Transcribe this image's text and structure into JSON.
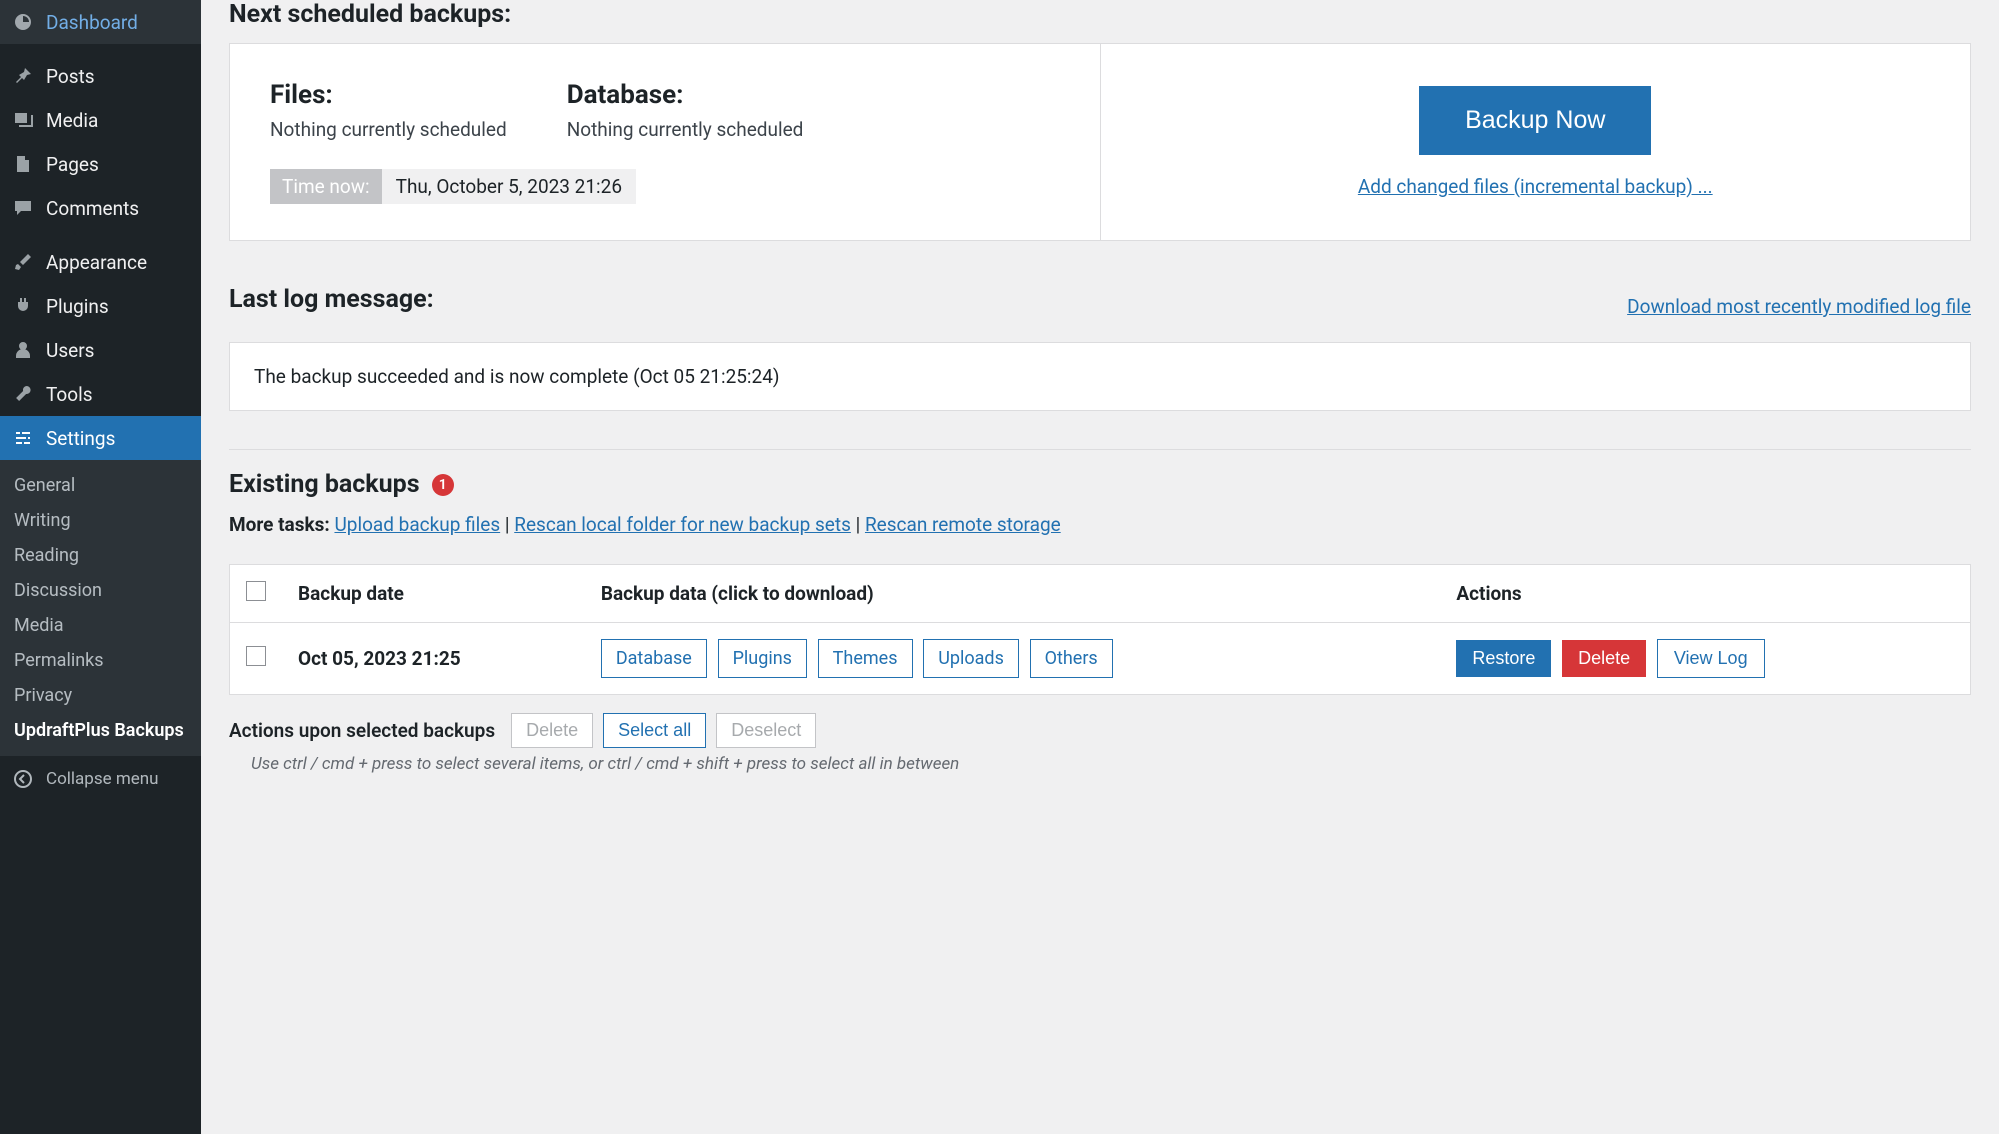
{
  "sidebar": {
    "items": [
      {
        "label": "Dashboard",
        "name": "dashboard"
      },
      {
        "label": "Posts",
        "name": "posts"
      },
      {
        "label": "Media",
        "name": "media"
      },
      {
        "label": "Pages",
        "name": "pages"
      },
      {
        "label": "Comments",
        "name": "comments"
      },
      {
        "label": "Appearance",
        "name": "appearance"
      },
      {
        "label": "Plugins",
        "name": "plugins"
      },
      {
        "label": "Users",
        "name": "users"
      },
      {
        "label": "Tools",
        "name": "tools"
      },
      {
        "label": "Settings",
        "name": "settings"
      }
    ],
    "submenu": [
      "General",
      "Writing",
      "Reading",
      "Discussion",
      "Media",
      "Permalinks",
      "Privacy",
      "UpdraftPlus Backups"
    ],
    "collapse": "Collapse menu"
  },
  "schedule": {
    "heading": "Next scheduled backups:",
    "files_label": "Files:",
    "files_status": "Nothing currently scheduled",
    "db_label": "Database:",
    "db_status": "Nothing currently scheduled",
    "time_now_label": "Time now:",
    "time_now_value": "Thu, October 5, 2023 21:26",
    "backup_now": "Backup Now",
    "incremental_link": "Add changed files (incremental backup) ..."
  },
  "log": {
    "heading": "Last log message:",
    "download_link": "Download most recently modified log file",
    "message": "The backup succeeded and is now complete (Oct 05 21:25:24)"
  },
  "existing": {
    "heading": "Existing backups",
    "count": "1",
    "more_tasks_label": "More tasks:",
    "upload_link": "Upload backup files",
    "rescan_local_link": "Rescan local folder for new backup sets",
    "rescan_remote_link": "Rescan remote storage",
    "th_date": "Backup date",
    "th_data": "Backup data (click to download)",
    "th_actions": "Actions",
    "row": {
      "date": "Oct 05, 2023 21:25",
      "data": [
        "Database",
        "Plugins",
        "Themes",
        "Uploads",
        "Others"
      ],
      "restore": "Restore",
      "delete": "Delete",
      "view_log": "View Log"
    },
    "actions_label": "Actions upon selected backups",
    "delete_btn": "Delete",
    "select_all_btn": "Select all",
    "deselect_btn": "Deselect",
    "hint": "Use ctrl / cmd + press to select several items, or ctrl / cmd + shift + press to select all in between"
  }
}
